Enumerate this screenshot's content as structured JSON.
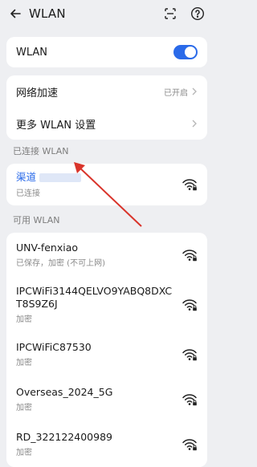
{
  "header": {
    "title": "WLAN"
  },
  "wlan_toggle": {
    "label": "WLAN",
    "on": true
  },
  "settings": [
    {
      "label": "网络加速",
      "value": "已开启"
    },
    {
      "label": "更多 WLAN 设置",
      "value": ""
    }
  ],
  "connected": {
    "section_label": "已连接 WLAN",
    "network": {
      "name": "渠道",
      "status": "已连接"
    }
  },
  "available": {
    "section_label": "可用 WLAN",
    "networks": [
      {
        "name": "UNV-fenxiao",
        "status": "已保存，加密 (不可上网)"
      },
      {
        "name": "IPCWiFi3144QELVO9YABQ8DXCT8S9Z6J",
        "status": "加密"
      },
      {
        "name": "IPCWiFiC87530",
        "status": "加密"
      },
      {
        "name": "Overseas_2024_5G",
        "status": "加密"
      },
      {
        "name": "RD_322122400989",
        "status": "加密"
      }
    ]
  },
  "colors": {
    "accent": "#2a6ae9",
    "annotation_arrow": "#d9342b"
  },
  "icons": [
    "back-arrow-icon",
    "scan-icon",
    "help-icon",
    "chevron-right-icon",
    "wifi-lock-icon"
  ]
}
